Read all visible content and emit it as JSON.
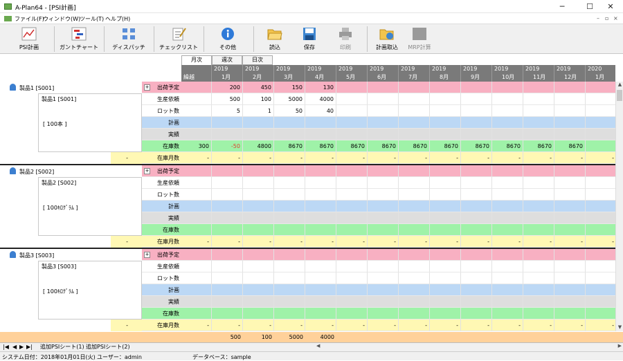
{
  "window": {
    "title": "A-Plan64 - [PSI計画]",
    "min": "─",
    "max": "☐",
    "close": "✕"
  },
  "menu": {
    "items": [
      "ファイル(F)",
      "ウィンドウ(W)",
      "ツール(T)",
      "ヘルプ(H)"
    ],
    "mdi": [
      "–",
      "▫",
      "×"
    ]
  },
  "toolbar": {
    "psi": "PSI計画",
    "gantt": "ガントチャート",
    "dispatch": "ディスパッチ",
    "checklist": "チェックリスト",
    "other": "その他",
    "load": "読込",
    "save": "保存",
    "print": "印刷",
    "plan_import": "計画取込",
    "mrp": "MRP計算"
  },
  "view_tabs": [
    "月次",
    "週次",
    "日次"
  ],
  "columns": {
    "carry": "繰越",
    "months": [
      [
        "2019",
        "1月"
      ],
      [
        "2019",
        "2月"
      ],
      [
        "2019",
        "3月"
      ],
      [
        "2019",
        "4月"
      ],
      [
        "2019",
        "5月"
      ],
      [
        "2019",
        "6月"
      ],
      [
        "2019",
        "7月"
      ],
      [
        "2019",
        "8月"
      ],
      [
        "2019",
        "9月"
      ],
      [
        "2019",
        "10月"
      ],
      [
        "2019",
        "11月"
      ],
      [
        "2019",
        "12月"
      ],
      [
        "2020",
        "1月"
      ]
    ]
  },
  "row_labels": [
    "出荷予定",
    "生産依頼",
    "ロット数",
    "計画",
    "実績",
    "在庫数",
    "在庫月数"
  ],
  "expand_glyph": "+",
  "products": [
    {
      "name": "製品1 [S001]",
      "box_name": "製品1 [S001]",
      "unit": "[ 100本 ]",
      "carry_month": "-",
      "ship": [
        "200",
        "450",
        "150",
        "130",
        "",
        "",
        "",
        "",
        "",
        "",
        "",
        "",
        ""
      ],
      "request": [
        "500",
        "100",
        "5000",
        "4000",
        "",
        "",
        "",
        "",
        "",
        "",
        "",
        "",
        ""
      ],
      "lots": [
        "5",
        "1",
        "50",
        "40",
        "",
        "",
        "",
        "",
        "",
        "",
        "",
        "",
        ""
      ],
      "stock_carry": "300",
      "stock": [
        "-50",
        "4800",
        "8670",
        "8670",
        "8670",
        "8670",
        "8670",
        "8670",
        "8670",
        "8670",
        "8670",
        "8670",
        ""
      ],
      "months": [
        "-",
        "-",
        "-",
        "-",
        "-",
        "-",
        "-",
        "-",
        "-",
        "-",
        "-",
        "-",
        "-"
      ]
    },
    {
      "name": "製品2 [S002]",
      "box_name": "製品2 [S002]",
      "unit": "[ 100ｷﾛｸﾞﾗﾑ ]",
      "carry_month": "-",
      "ship": [
        "",
        "",
        "",
        "",
        "",
        "",
        "",
        "",
        "",
        "",
        "",
        "",
        ""
      ],
      "request": [
        "",
        "",
        "",
        "",
        "",
        "",
        "",
        "",
        "",
        "",
        "",
        "",
        ""
      ],
      "lots": [
        "",
        "",
        "",
        "",
        "",
        "",
        "",
        "",
        "",
        "",
        "",
        "",
        ""
      ],
      "stock_carry": "",
      "stock": [
        "",
        "",
        "",
        "",
        "",
        "",
        "",
        "",
        "",
        "",
        "",
        "",
        ""
      ],
      "months": [
        "-",
        "-",
        "-",
        "-",
        "-",
        "-",
        "-",
        "-",
        "-",
        "-",
        "-",
        "-",
        "-"
      ]
    },
    {
      "name": "製品3 [S003]",
      "box_name": "製品3 [S003]",
      "unit": "[ 100ｷﾛｸﾞﾗﾑ ]",
      "carry_month": "-",
      "ship": [
        "",
        "",
        "",
        "",
        "",
        "",
        "",
        "",
        "",
        "",
        "",
        "",
        ""
      ],
      "request": [
        "",
        "",
        "",
        "",
        "",
        "",
        "",
        "",
        "",
        "",
        "",
        "",
        ""
      ],
      "lots": [
        "",
        "",
        "",
        "",
        "",
        "",
        "",
        "",
        "",
        "",
        "",
        "",
        ""
      ],
      "stock_carry": "",
      "stock": [
        "",
        "",
        "",
        "",
        "",
        "",
        "",
        "",
        "",
        "",
        "",
        "",
        ""
      ],
      "months": [
        "-",
        "-",
        "-",
        "-",
        "-",
        "-",
        "-",
        "-",
        "-",
        "-",
        "-",
        "-",
        "-"
      ]
    }
  ],
  "totals": [
    "500",
    "100",
    "5000",
    "4000"
  ],
  "sheet_nav": [
    "|◀",
    "◀",
    "▶",
    "▶|"
  ],
  "sheet_tabs": [
    "追加PSIシート(1)",
    "追加PSIシート(2)"
  ],
  "status": {
    "date": "システム日付：2018年01月01日(火)",
    "user": "ユーザー：admin",
    "db": "データベース：sample"
  },
  "scroll": {
    "up": "▲",
    "down": "▼",
    "left": "◀",
    "right": "▶"
  }
}
